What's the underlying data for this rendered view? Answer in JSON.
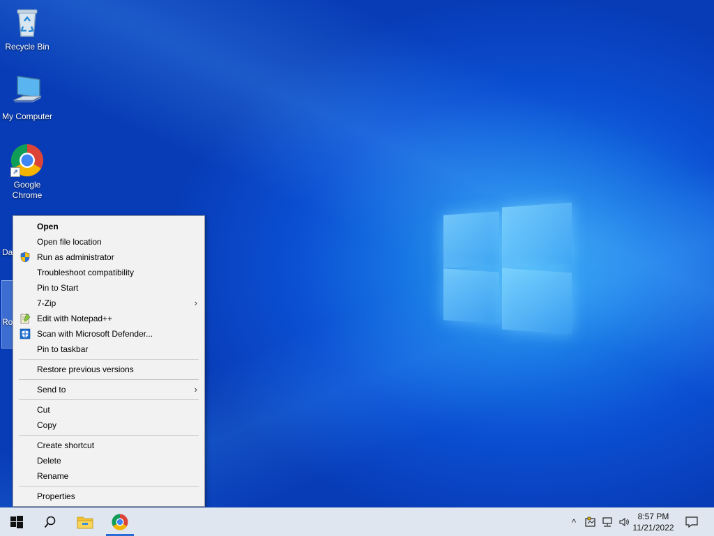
{
  "desktop": {
    "icons": [
      {
        "label": "Recycle Bin"
      },
      {
        "label": "My Computer"
      },
      {
        "label": "Google Chrome"
      }
    ],
    "partial_labels": [
      "Da",
      "Ro"
    ]
  },
  "context_menu": {
    "items": [
      {
        "label": "Open",
        "bold": true
      },
      {
        "label": "Open file location"
      },
      {
        "label": "Run as administrator",
        "icon": "uac-shield-icon"
      },
      {
        "label": "Troubleshoot compatibility"
      },
      {
        "label": "Pin to Start"
      },
      {
        "label": "7-Zip",
        "submenu": true
      },
      {
        "label": "Edit with Notepad++",
        "icon": "notepadpp-icon"
      },
      {
        "label": "Scan with Microsoft Defender...",
        "icon": "defender-icon"
      },
      {
        "label": "Pin to taskbar"
      },
      {
        "label": "Restore previous versions"
      },
      {
        "label": "Send to",
        "submenu": true
      },
      {
        "label": "Cut"
      },
      {
        "label": "Copy"
      },
      {
        "label": "Create shortcut"
      },
      {
        "label": "Delete"
      },
      {
        "label": "Rename"
      },
      {
        "label": "Properties"
      }
    ],
    "arrow_glyph": "›"
  },
  "taskbar": {
    "start_icon": "windows-start-icon",
    "search_icon": "search-icon",
    "apps": [
      "file-explorer-icon",
      "chrome-icon"
    ],
    "tray": {
      "chevron": "^",
      "clock_time": "8:57 PM",
      "clock_date": "11/21/2022"
    }
  },
  "colors": {
    "menu_bg": "#f2f2f2",
    "taskbar_bg": "#dfe6ef",
    "accent": "#2b6cd4"
  }
}
